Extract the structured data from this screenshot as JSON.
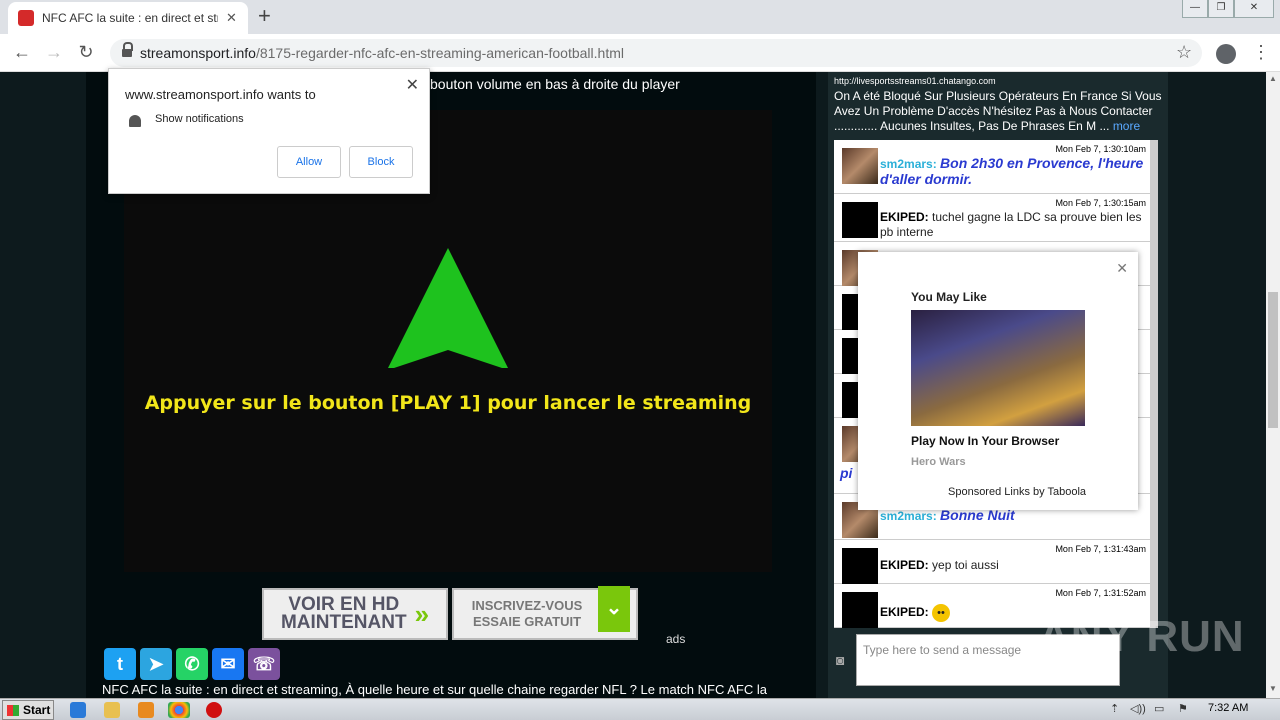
{
  "browser": {
    "tab_title": "NFC AFC la suite : en direct et strea",
    "url_host": "streamonsport.info",
    "url_path": "/8175-regarder-nfc-afc-en-streaming-american-football.html"
  },
  "notification": {
    "title": "www.streamonsport.info wants to",
    "permission": "Show notifications",
    "allow": "Allow",
    "block": "Block"
  },
  "page": {
    "top_text": "bouton volume en bas à droite du player",
    "play_text": "Appuyer sur le bouton [PLAY 1] pour lancer le streaming",
    "ad_hd_line1": "VOIR EN HD",
    "ad_hd_line2": "MAINTENANT",
    "ad_sub_line1": "INSCRIVEZ-VOUS",
    "ad_sub_line2": "ESSAIE GRATUIT",
    "ads_label": "ads",
    "bottom_text": "NFC AFC la suite : en direct et streaming, À quelle heure et sur quelle chaine regarder NFL ? Le match NFC AFC la"
  },
  "chat": {
    "header_link": "http://livesportsstreams01.chatango.com",
    "header_text": "On A été Bloqué Sur Plusieurs Opérateurs En France Si Vous Avez Un Problème D'accès N'hésitez Pas à Nous Contacter ............. Aucunes Insultes, Pas De Phrases En M ...",
    "more": "more",
    "messages": [
      {
        "time": "Mon Feb 7, 1:30:10am",
        "user": "sm2mars:",
        "text": "Bon 2h30 en Provence, l'heure d'aller dormir."
      },
      {
        "time": "Mon Feb 7, 1:30:15am",
        "user": "EKIPED:",
        "text": "tuchel gagne la LDC sa prouve bien les pb interne"
      },
      {
        "time": "",
        "user": "sm2mars:",
        "text": "Bonne Nuit"
      },
      {
        "time": "Mon Feb 7, 1:31:43am",
        "user": "EKIPED:",
        "text": "yep toi aussi"
      },
      {
        "time": "Mon Feb 7, 1:31:52am",
        "user": "EKIPED:",
        "text": ""
      }
    ],
    "partial_text": "pi",
    "input_placeholder": "Type here to send a message"
  },
  "taboola": {
    "title": "You May Like",
    "headline": "Play Now In Your Browser",
    "brand": "Hero Wars",
    "footer": "Sponsored Links by Taboola"
  },
  "taskbar": {
    "start": "Start",
    "clock": "7:32 AM"
  },
  "watermark": "ANY RUN"
}
